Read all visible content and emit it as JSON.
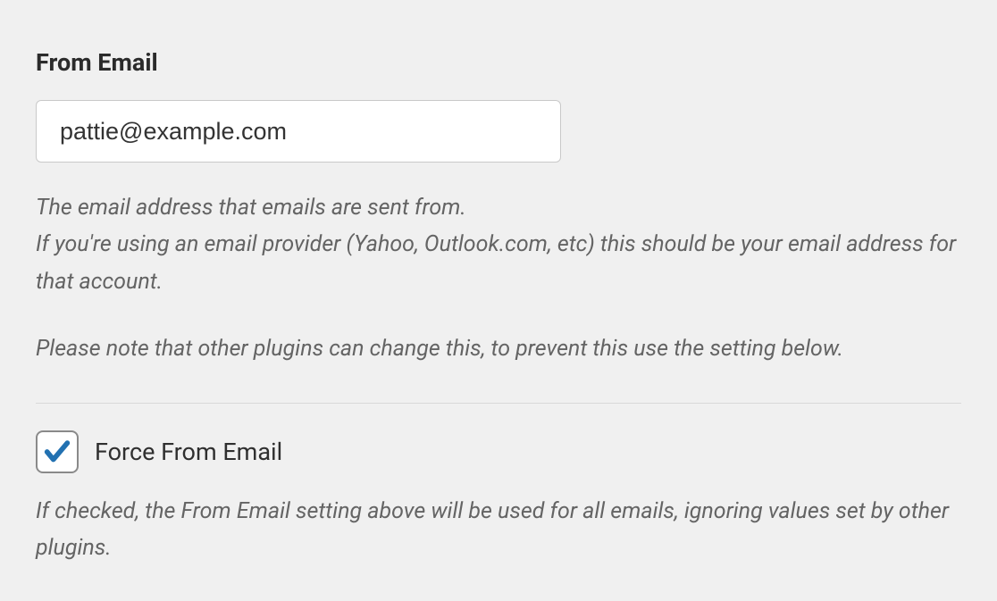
{
  "from_email": {
    "heading": "From Email",
    "value": "pattie@example.com",
    "description_1": "The email address that emails are sent from.\nIf you're using an email provider (Yahoo, Outlook.com, etc) this should be your email address for that account.",
    "description_2": "Please note that other plugins can change this, to prevent this use the setting below."
  },
  "force_from_email": {
    "label": "Force From Email",
    "checked": true,
    "description": "If checked, the From Email setting above will be used for all emails, ignoring values set by other plugins."
  }
}
